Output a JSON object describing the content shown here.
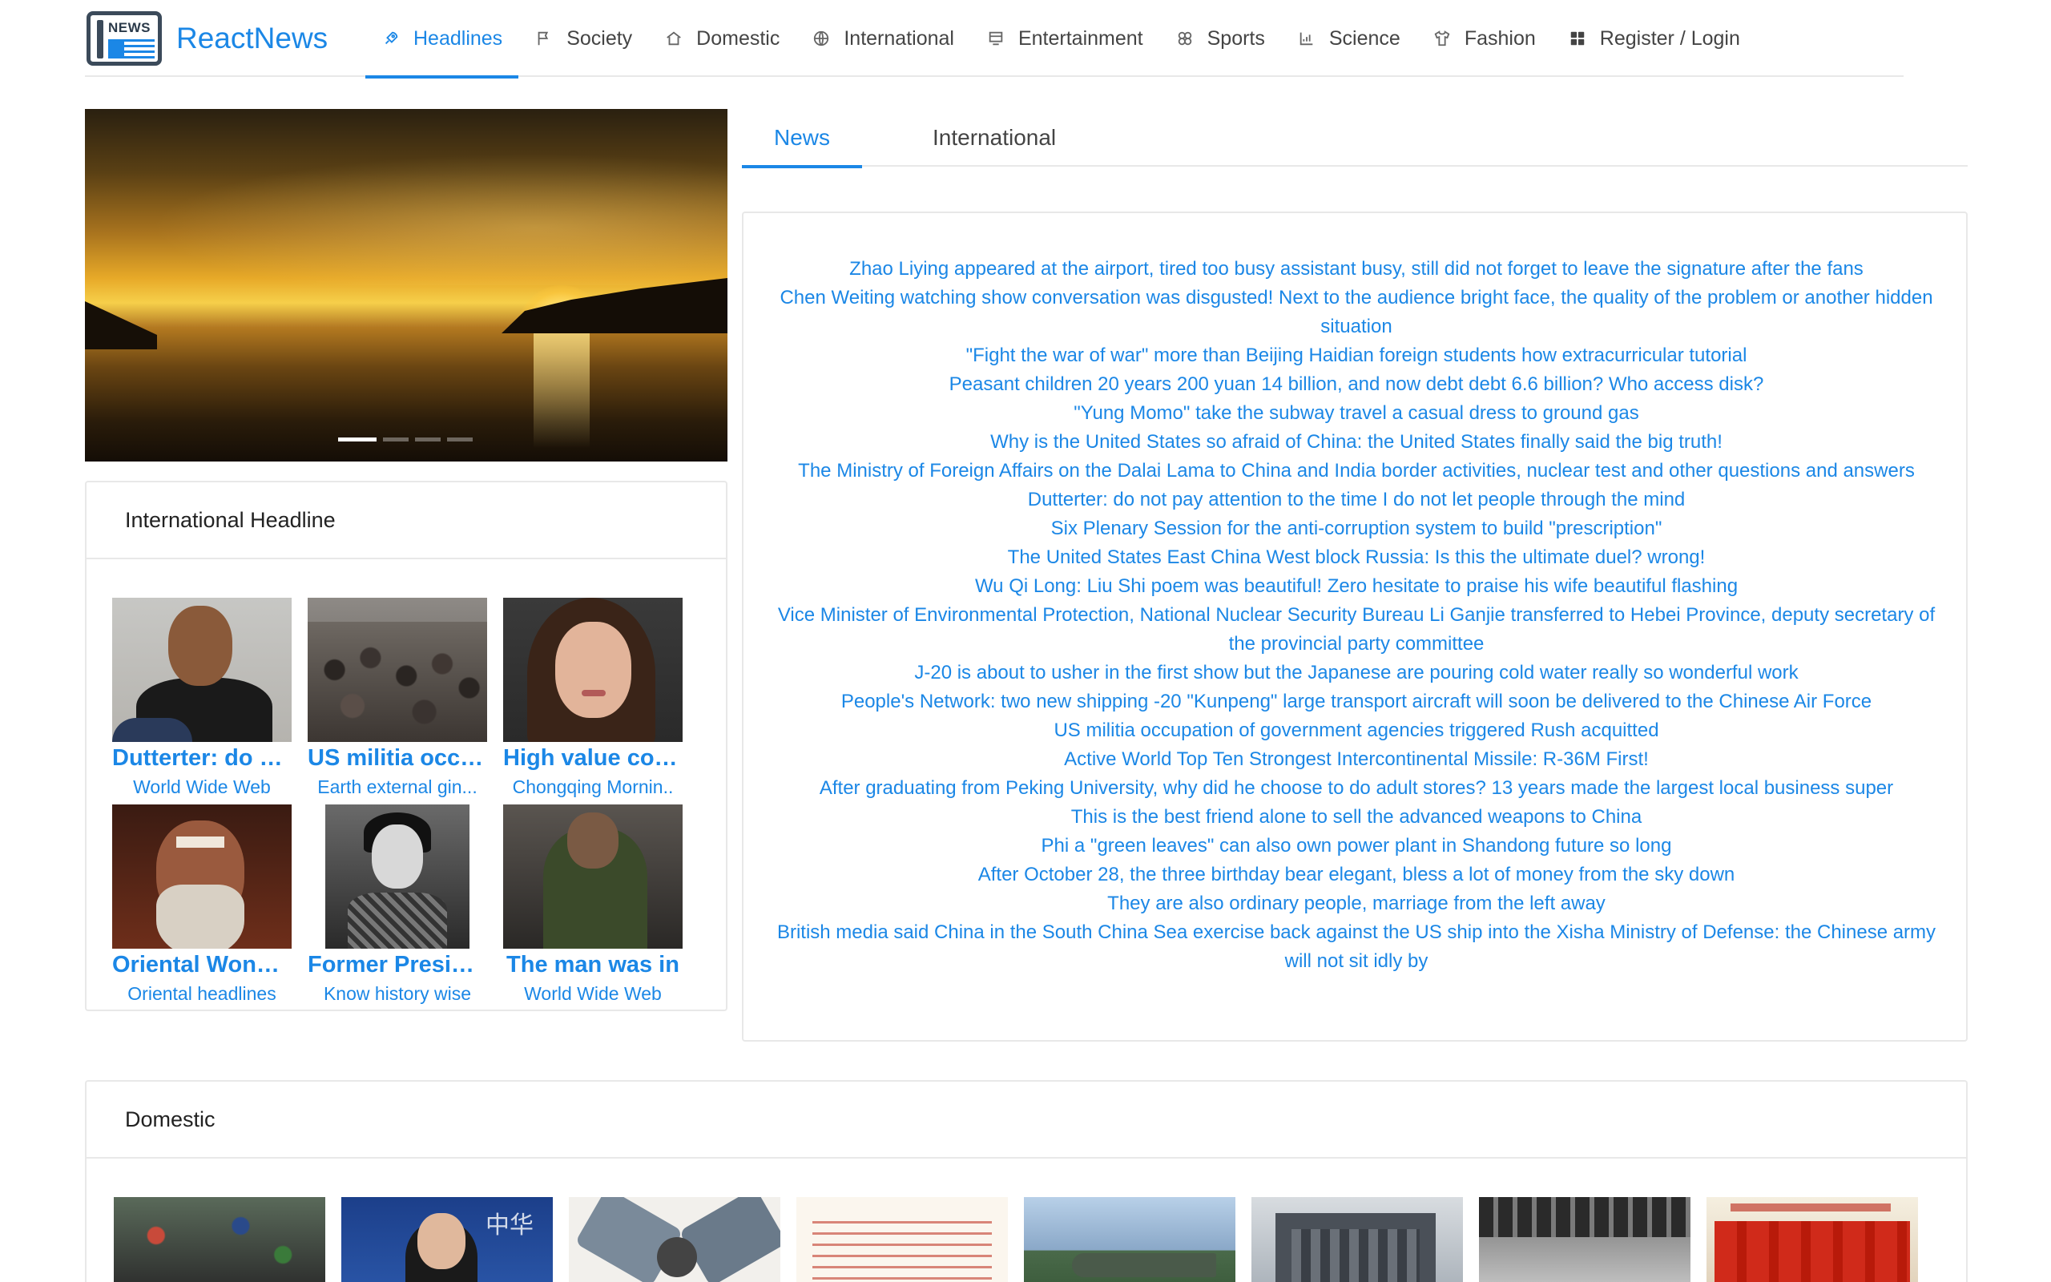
{
  "app": {
    "title": "ReactNews",
    "logo_badge": "NEWS"
  },
  "nav": {
    "items": [
      {
        "label": "Headlines",
        "icon": "rocket-icon",
        "active": true
      },
      {
        "label": "Society",
        "icon": "flag-icon",
        "active": false
      },
      {
        "label": "Domestic",
        "icon": "home-icon",
        "active": false
      },
      {
        "label": "International",
        "icon": "globe-icon",
        "active": false
      },
      {
        "label": "Entertainment",
        "icon": "laptop-icon",
        "active": false
      },
      {
        "label": "Sports",
        "icon": "dribbble-icon",
        "active": false
      },
      {
        "label": "Science",
        "icon": "chart-icon",
        "active": false
      },
      {
        "label": "Fashion",
        "icon": "skin-icon",
        "active": false
      },
      {
        "label": "Register / Login",
        "icon": "appstore-icon",
        "active": false
      }
    ]
  },
  "carousel": {
    "slide_count": 4,
    "active_index": 0
  },
  "international_headline": {
    "title": "International Headline",
    "items": [
      {
        "title": "Dutterter: do not pay attention to the time",
        "source": "World Wide Web"
      },
      {
        "title": "US militia occupation of government agencies",
        "source": "Earth external gin..."
      },
      {
        "title": "High value could",
        "source": "Chongqing Mornin.."
      },
      {
        "title": "Oriental Wonders",
        "source": "Oriental headlines"
      },
      {
        "title": "Former President",
        "source": "Know history wise"
      },
      {
        "title": "The man was in",
        "source": "World Wide Web"
      }
    ]
  },
  "tabs": [
    {
      "label": "News",
      "active": true
    },
    {
      "label": "International",
      "active": false
    }
  ],
  "news_list": [
    "Zhao Liying appeared at the airport, tired too busy assistant busy, still did not forget to leave the signature after the fans",
    "Chen Weiting watching show conversation was disgusted! Next to the audience bright face, the quality of the problem or another hidden situation",
    "\"Fight the war of war\" more than Beijing Haidian foreign students how extracurricular tutorial",
    "Peasant children 20 years 200 yuan 14 billion, and now debt debt 6.6 billion? Who access disk?",
    "\"Yung Momo\" take the subway travel a casual dress to ground gas",
    "Why is the United States so afraid of China: the United States finally said the big truth!",
    "The Ministry of Foreign Affairs on the Dalai Lama to China and India border activities, nuclear test and other questions and answers",
    "Dutterter: do not pay attention to the time I do not let people through the mind",
    "Six Plenary Session for the anti-corruption system to build \"prescription\"",
    "The United States East China West block Russia: Is this the ultimate duel? wrong!",
    "Wu Qi Long: Liu Shi poem was beautiful! Zero hesitate to praise his wife beautiful flashing",
    "Vice Minister of Environmental Protection, National Nuclear Security Bureau Li Ganjie transferred to Hebei Province, deputy secretary of the provincial party committee",
    "J-20 is about to usher in the first show but the Japanese are pouring cold water really so wonderful work",
    "People's Network: two new shipping -20 \"Kunpeng\" large transport aircraft will soon be delivered to the Chinese Air Force",
    "US militia occupation of government agencies triggered Rush acquitted",
    "Active World Top Ten Strongest Intercontinental Missile: R-36M First!",
    "After graduating from Peking University, why did he choose to do adult stores? 13 years made the largest local business super",
    "This is the best friend alone to sell the advanced weapons to China",
    "Phi a \"green leaves\" can also own power plant in Shandong future so long",
    "After October 28, the three birthday bear elegant, bless a lot of money from the sky down",
    "They are also ordinary people, marriage from the left away",
    "British media said China in the South China Sea exercise back against the US ship into the Xisha Ministry of Defense: the Chinese army will not sit idly by"
  ],
  "domestic": {
    "title": "Domestic",
    "thumb_count": 8,
    "thumb_texts": {
      "press_backdrop": "中华",
      "document_header": "李干杰同志任河北省委副书记"
    }
  },
  "colors": {
    "accent": "#1b87e6",
    "text": "#333333",
    "border": "#e8e8e8"
  }
}
